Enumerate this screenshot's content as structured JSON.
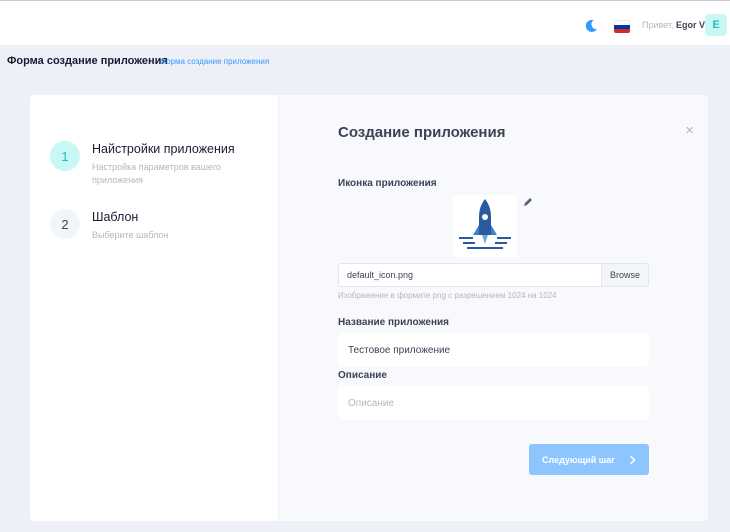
{
  "header": {
    "theme_icon": "moon-icon",
    "language_icon": "russian-flag-icon",
    "colors": {
      "flag_white": "#ffffff",
      "flag_blue": "#0039a6",
      "flag_red": "#d52b1e"
    },
    "greeting": "Привет,",
    "user_name": "Egor V",
    "avatar_letter": "E"
  },
  "subheader": {
    "title": "Форма создание приложения",
    "breadcrumb": "Форма создание приложения"
  },
  "wizard": {
    "steps": [
      {
        "number": "1",
        "title": "Найстройки приложения",
        "description": "Настройка параметров вашего приложения",
        "active": true
      },
      {
        "number": "2",
        "title": "Шаблон",
        "description": "Выберите шаблон",
        "active": false
      }
    ]
  },
  "form": {
    "title": "Создание приложения",
    "close_icon": "close-icon",
    "icon_label": "Иконка приложения",
    "icon_preview": "rocket-icon",
    "edit_icon": "pencil-icon",
    "file_name": "default_icon.png",
    "browse_label": "Browse",
    "file_hint": "Изображение в формате png с разрешением 1024 на 1024",
    "name_label": "Название приложения",
    "name_value": "Тестовое приложение",
    "description_label": "Описание",
    "description_placeholder": "Описание",
    "next_label": "Следующий шаг",
    "next_icon": "chevron-right-icon",
    "accent_color": "#8dc6ff"
  }
}
